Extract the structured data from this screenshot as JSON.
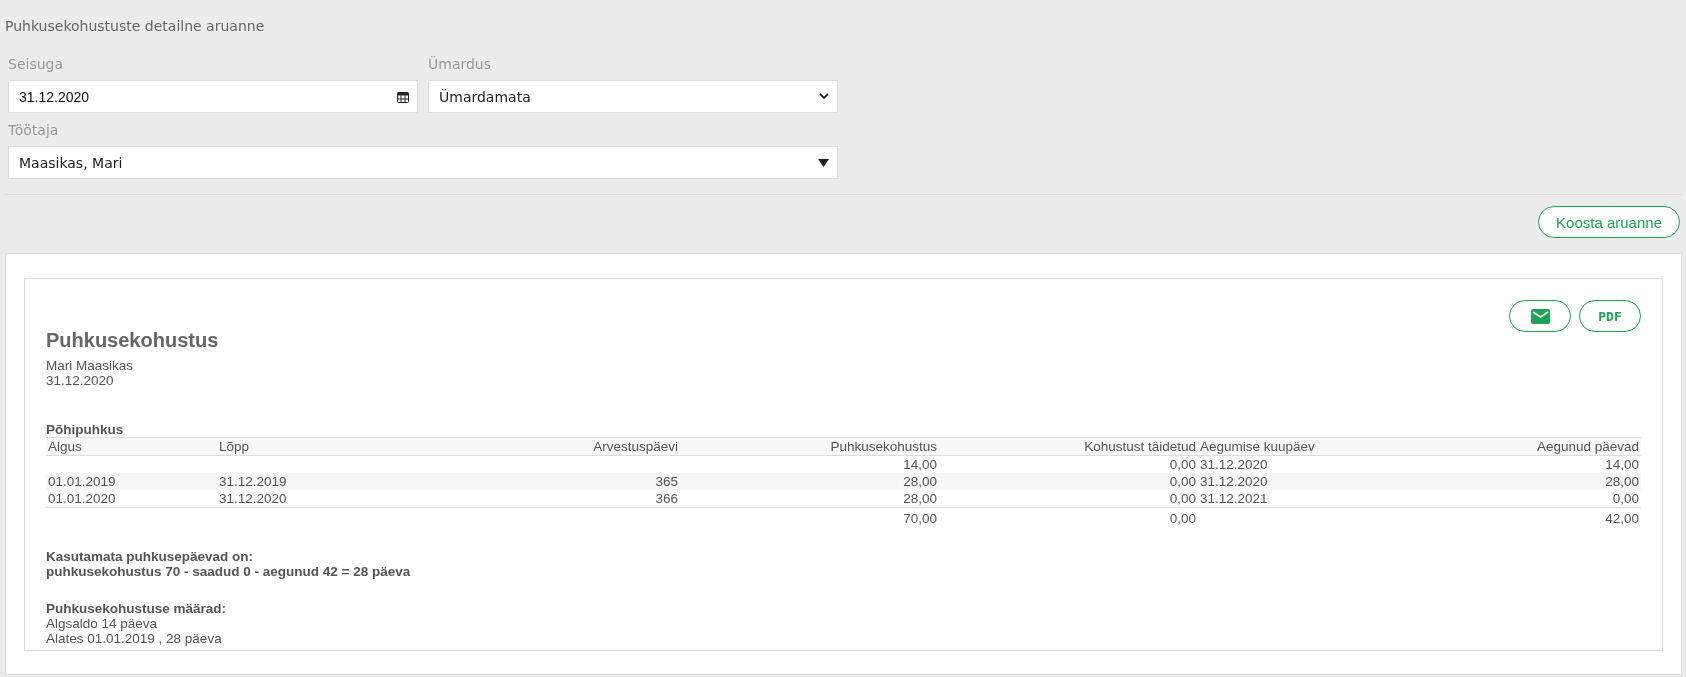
{
  "page_title": "Puhkusekohustuste detailne aruanne",
  "filters": {
    "as_of": {
      "label": "Seisuga",
      "value": "31.12.2020"
    },
    "rounding": {
      "label": "Ümardus",
      "value": "Ümardamata"
    },
    "employee": {
      "label": "Töötaja",
      "value": "Maasikas, Mari"
    }
  },
  "generate_button": "Koosta aruanne",
  "report": {
    "pdf_button": "PDF",
    "title": "Puhkusekohustus",
    "employee": "Mari Maasikas",
    "date": "31.12.2020",
    "section": "Põhipuhkus",
    "table": {
      "columns": [
        "Algus",
        "Lõpp",
        "Arvestuspäevi",
        "Puhkusekohustus",
        "Kohustust täidetud",
        "Aegumise kuupäev",
        "Aegunud päevad"
      ],
      "rows": [
        {
          "liability": "14,00",
          "fulfilled": "0,00",
          "expiry": "31.12.2020",
          "expired": "14,00"
        },
        {
          "start": "01.01.2019",
          "end": "31.12.2019",
          "days": "365",
          "liability": "28,00",
          "fulfilled": "0,00",
          "expiry": "31.12.2020",
          "expired": "28,00"
        },
        {
          "start": "01.01.2020",
          "end": "31.12.2020",
          "days": "366",
          "liability": "28,00",
          "fulfilled": "0,00",
          "expiry": "31.12.2021",
          "expired": "0,00"
        }
      ],
      "totals": {
        "liability": "70,00",
        "fulfilled": "0,00",
        "expired": "42,00"
      }
    },
    "summary_heading": "Kasutamata puhkusepäevad on:",
    "summary_formula": "puhkusekohustus 70 - saadud 0 - aegunud 42 = 28 päeva",
    "rates_heading": "Puhkusekohustuse määrad:",
    "rates": [
      "Algsaldo 14 päeva",
      "Alates 01.01.2019 , 28 päeva"
    ]
  }
}
